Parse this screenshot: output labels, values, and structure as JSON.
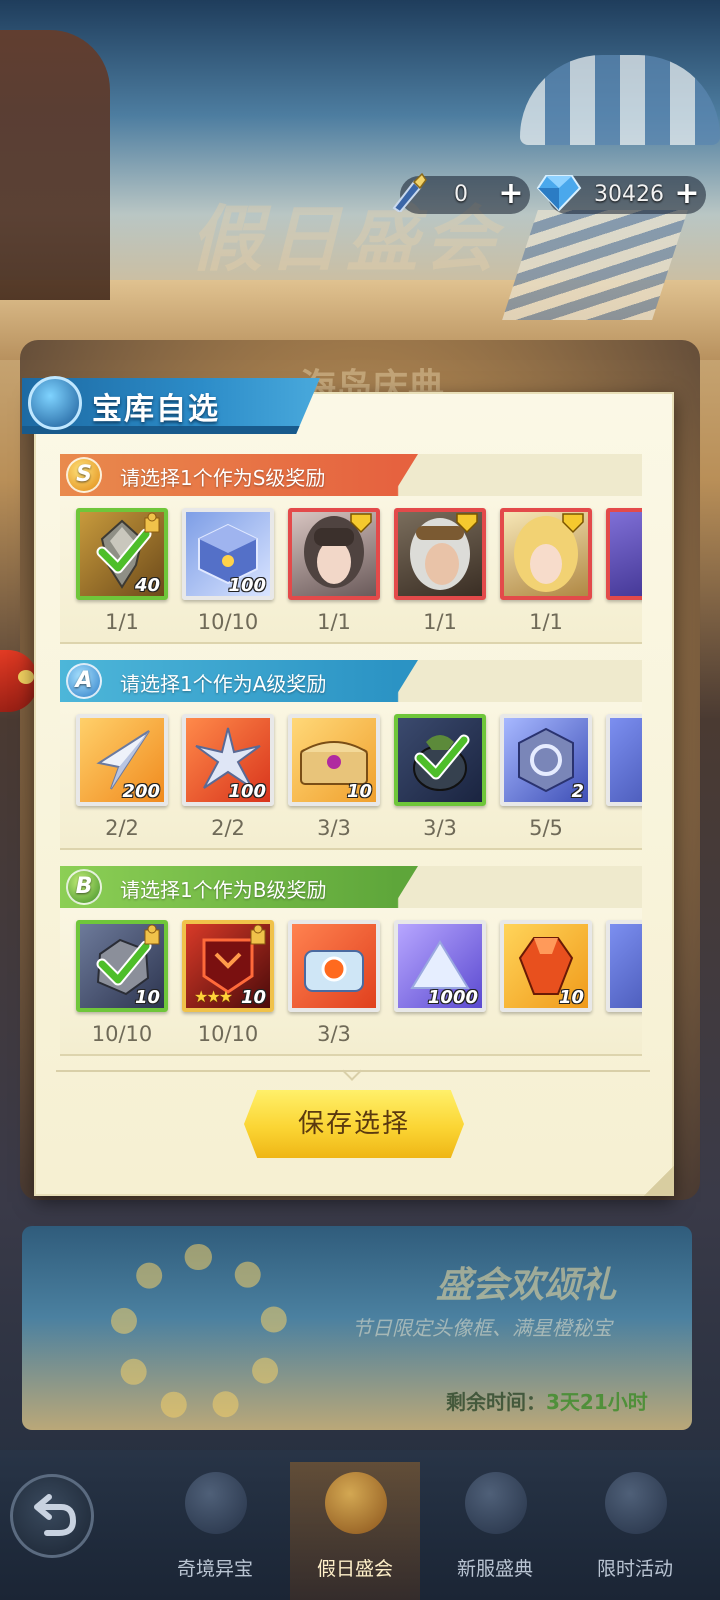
{
  "currency": {
    "torch_value": "0",
    "gem_value": "30426"
  },
  "background": {
    "event_title": "假日盛会",
    "banner_text": "海岛庆典"
  },
  "dialog": {
    "title": "宝库自选",
    "save_label": "保存选择"
  },
  "sections": [
    {
      "grade": "S",
      "label": "请选择1个作为S级奖励",
      "items": [
        {
          "icon": "drill-shard-icon",
          "count": "40",
          "stock": "1/1",
          "selected": true
        },
        {
          "icon": "crystal-cube-icon",
          "count": "100",
          "stock": "10/10",
          "selected": false
        },
        {
          "icon": "hero-portrait-icon",
          "count": "",
          "stock": "1/1",
          "selected": false
        },
        {
          "icon": "hero-portrait-icon",
          "count": "",
          "stock": "1/1",
          "selected": false
        },
        {
          "icon": "hero-portrait-icon",
          "count": "",
          "stock": "1/1",
          "selected": false
        }
      ]
    },
    {
      "grade": "A",
      "label": "请选择1个作为A级奖励",
      "items": [
        {
          "icon": "silver-shard-icon",
          "count": "200",
          "stock": "2/2",
          "selected": false
        },
        {
          "icon": "star-shard-icon",
          "count": "100",
          "stock": "2/2",
          "selected": false
        },
        {
          "icon": "treasure-chest-icon",
          "count": "10",
          "stock": "3/3",
          "selected": false
        },
        {
          "icon": "ore-pouch-icon",
          "count": "",
          "stock": "3/3",
          "selected": true
        },
        {
          "icon": "rune-stone-icon",
          "count": "2",
          "stock": "5/5",
          "selected": false
        }
      ]
    },
    {
      "grade": "B",
      "label": "请选择1个作为B级奖励",
      "items": [
        {
          "icon": "gray-ore-icon",
          "count": "10",
          "stock": "10/10",
          "selected": true
        },
        {
          "icon": "star-emblem-icon",
          "count": "10",
          "stock": "10/10",
          "selected": false
        },
        {
          "icon": "blue-chest-icon",
          "count": "",
          "stock": "3/3",
          "selected": false
        },
        {
          "icon": "crystal-pile-icon",
          "count": "1000",
          "stock": "",
          "selected": false
        },
        {
          "icon": "fire-gem-icon",
          "count": "10",
          "stock": "",
          "selected": false
        }
      ]
    }
  ],
  "promo": {
    "title": "盛会欢颂礼",
    "subtitle": "节日限定头像框、满星橙秘宝",
    "time_label": "剩余时间：",
    "time_value": "3天21小时"
  },
  "nav": {
    "tabs": [
      {
        "label": "奇境异宝"
      },
      {
        "label": "假日盛会"
      },
      {
        "label": "新服盛典"
      },
      {
        "label": "限时活动"
      }
    ]
  },
  "colors": {
    "accent_blue": "#2c8cc8",
    "s_header": "#e27b4a",
    "a_header": "#3aa7c9",
    "b_header": "#79b94a",
    "save_button": "#fbd534"
  }
}
